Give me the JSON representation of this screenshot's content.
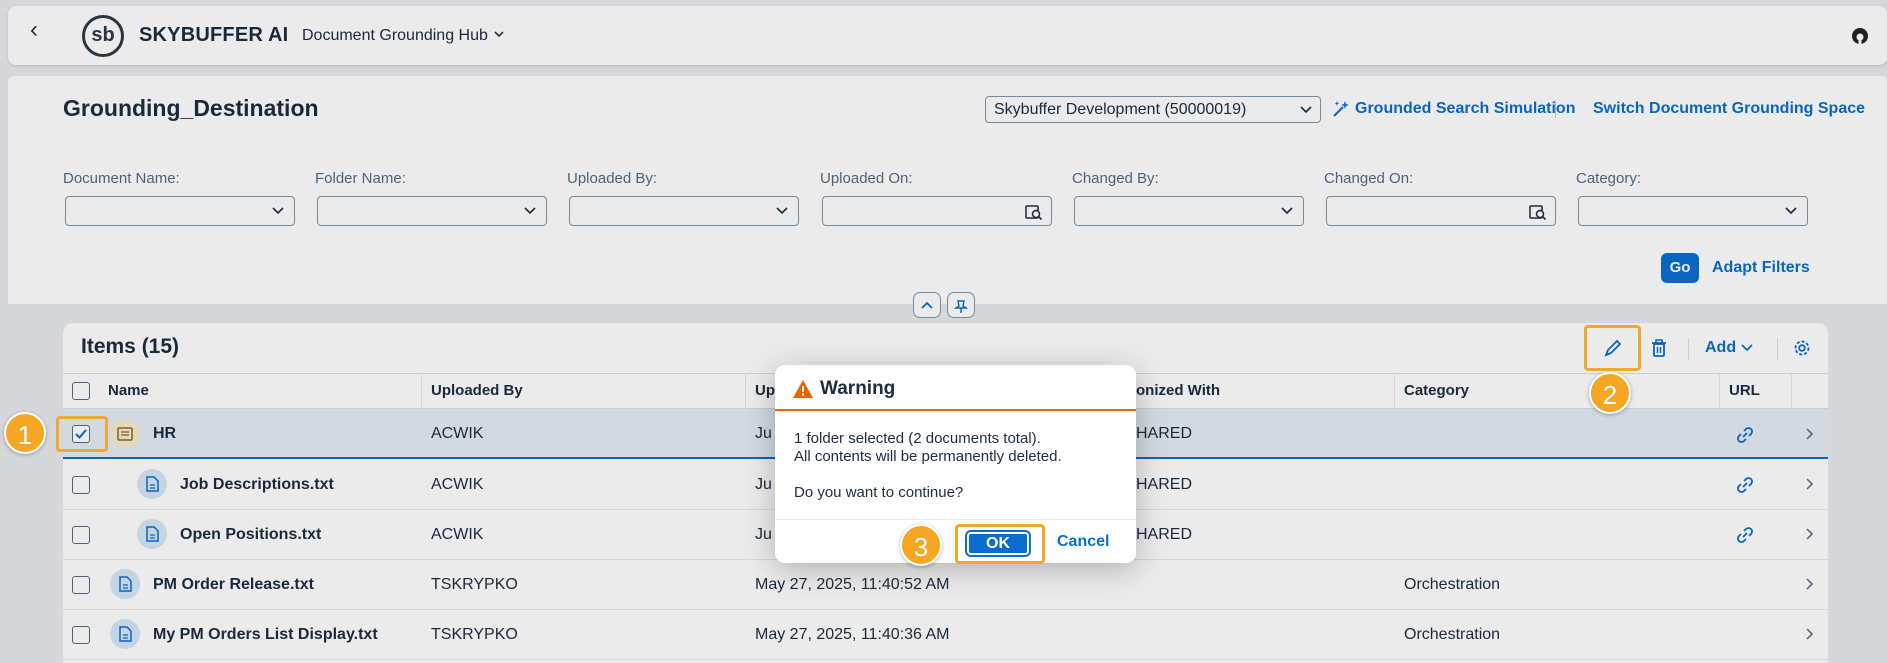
{
  "shell": {
    "brand": "SKYBUFFER AI",
    "logo_text": "sb",
    "app_name": "Document Grounding Hub"
  },
  "header": {
    "title": "Grounding_Destination",
    "space_select_value": "Skybuffer Development (50000019)",
    "simulation_link": "Grounded Search Simulation",
    "switch_link": "Switch Document Grounding Space"
  },
  "filters": {
    "labels": [
      "Document Name:",
      "Folder Name:",
      "Uploaded By:",
      "Uploaded On:",
      "Changed By:",
      "Changed On:",
      "Category:"
    ],
    "go": "Go",
    "adapt": "Adapt Filters"
  },
  "table": {
    "title": "Items (15)",
    "add_label": "Add",
    "columns": [
      "Name",
      "Uploaded By",
      "Up",
      "onized With",
      "Category",
      "URL"
    ],
    "rows": [
      {
        "name": "HR",
        "uploaded_by": "ACWIK",
        "uploaded_on": "Ju",
        "sync": "HARED",
        "category": "",
        "type": "folder"
      },
      {
        "name": "Job Descriptions.txt",
        "uploaded_by": "ACWIK",
        "uploaded_on": "Ju",
        "sync": "HARED",
        "category": "",
        "type": "doc"
      },
      {
        "name": "Open Positions.txt",
        "uploaded_by": "ACWIK",
        "uploaded_on": "Ju",
        "sync": "HARED",
        "category": "",
        "type": "doc"
      },
      {
        "name": "PM Order Release.txt",
        "uploaded_by": "TSKRYPKO",
        "uploaded_on": "May 27, 2025, 11:40:52 AM",
        "sync": "",
        "category": "Orchestration",
        "type": "doc"
      },
      {
        "name": "My PM Orders List Display.txt",
        "uploaded_by": "TSKRYPKO",
        "uploaded_on": "May 27, 2025, 11:40:36 AM",
        "sync": "",
        "category": "Orchestration",
        "type": "doc"
      }
    ]
  },
  "dialog": {
    "title": "Warning",
    "line1": "1 folder selected (2 documents total).",
    "line2": "All contents will be permanently deleted.",
    "question": "Do you want to continue?",
    "ok": "OK",
    "cancel": "Cancel"
  },
  "annotations": {
    "step1": "1",
    "step2": "2",
    "step3": "3"
  },
  "colors": {
    "accent": "#0a6ed1",
    "warning": "#e76500",
    "highlight": "#f0a830"
  }
}
